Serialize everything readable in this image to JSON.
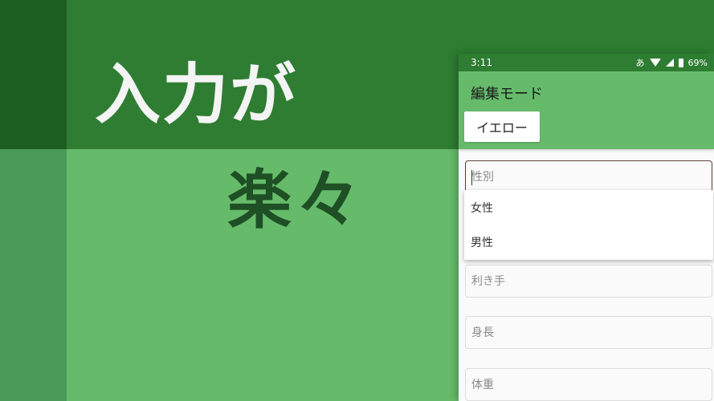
{
  "promo": {
    "headline": "入力が",
    "subline": "楽々"
  },
  "status_bar": {
    "time": "3:11",
    "ime": "あ",
    "battery": "69%"
  },
  "app_bar": {
    "title": "編集モード",
    "theme_button": "イエロー"
  },
  "form": {
    "gender_placeholder": "性別",
    "gender_options": [
      "女性",
      "男性"
    ],
    "handedness_placeholder": "利き手",
    "height_placeholder": "身長",
    "weight_placeholder": "体重"
  },
  "colors": {
    "dark_green": "#2e7d32",
    "light_green": "#66bb6a",
    "darkest_green": "#1b5e20"
  }
}
